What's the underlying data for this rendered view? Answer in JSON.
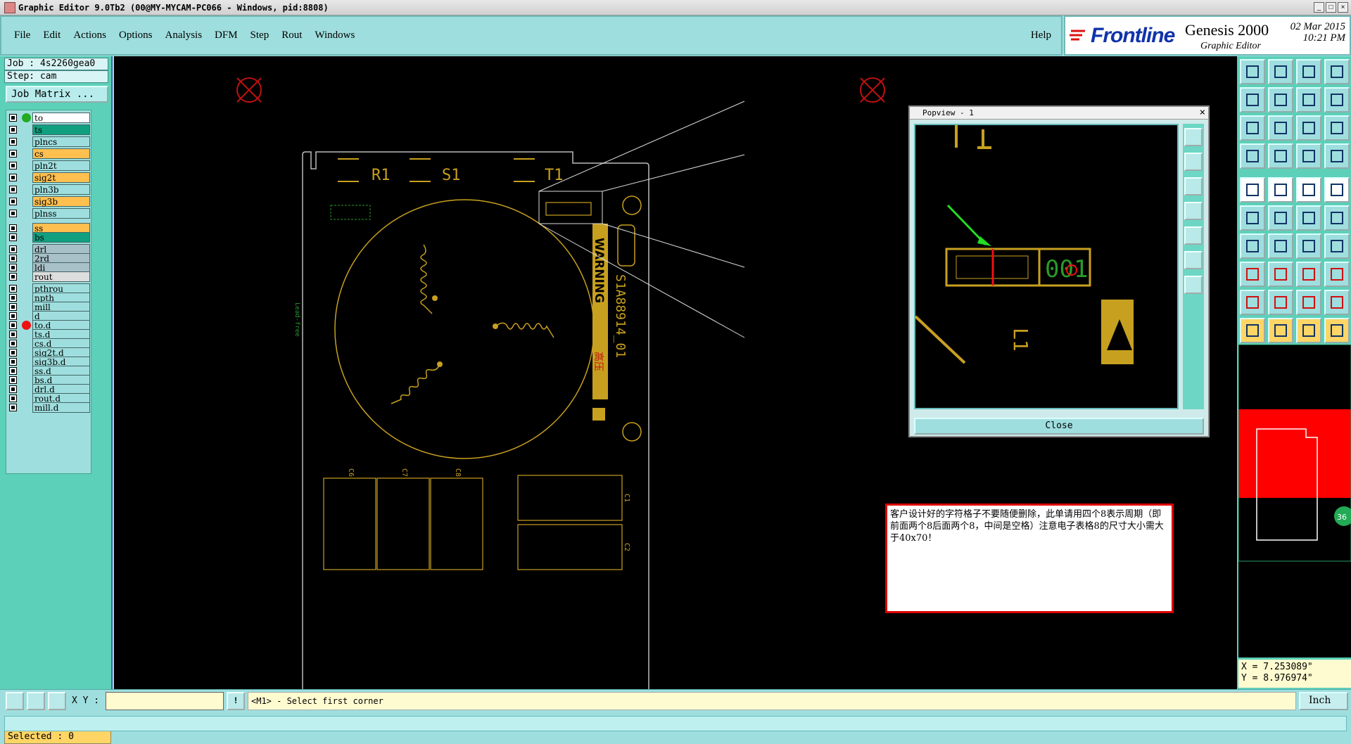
{
  "window": {
    "title": "Graphic Editor 9.0Tb2 (00@MY-MYCAM-PC066 - Windows, pid:8808)"
  },
  "menu": {
    "items": [
      "File",
      "Edit",
      "Actions",
      "Options",
      "Analysis",
      "DFM",
      "Step",
      "Rout",
      "Windows"
    ],
    "help": "Help"
  },
  "brand": {
    "logo": "Frontline",
    "product": "Genesis 2000",
    "subtitle": "Graphic Editor",
    "date": "02 Mar 2015",
    "time": "10:21 PM"
  },
  "job": {
    "job_line": "Job : 4s2260gea0",
    "step_line": "Step: cam",
    "matrix_button": "Job Matrix ..."
  },
  "layers": [
    {
      "name": "to",
      "color": "#ffffff",
      "dot": "#22aa22"
    },
    {
      "name": "ts",
      "color": "#10a080"
    },
    {
      "name": "plncs",
      "color": "#9fdede"
    },
    {
      "name": "cs",
      "color": "#ffc050"
    },
    {
      "name": "pln2t",
      "color": "#9fdede"
    },
    {
      "name": "sig2t",
      "color": "#ffc050"
    },
    {
      "name": "pln3b",
      "color": "#9fdede"
    },
    {
      "name": "sig3b",
      "color": "#ffc050"
    },
    {
      "name": "plnss",
      "color": "#9fdede"
    },
    {
      "name": "ss",
      "color": "#ffc050"
    },
    {
      "name": "bs",
      "color": "#10a080"
    },
    {
      "name": "drl",
      "color": "#a8c0c8"
    },
    {
      "name": "2rd",
      "color": "#a8c0c8"
    },
    {
      "name": "ldi",
      "color": "#a8c0c8"
    },
    {
      "name": "rout",
      "color": "#dddddd"
    },
    {
      "name": "pthrou",
      "color": "#9fdede"
    },
    {
      "name": "npth",
      "color": "#9fdede"
    },
    {
      "name": "mill",
      "color": "#9fdede"
    },
    {
      "name": "d",
      "color": "#9fdede"
    },
    {
      "name": "to.d",
      "color": "#9fdede",
      "dot": "#ee1111"
    },
    {
      "name": "ts.d",
      "color": "#9fdede"
    },
    {
      "name": "cs.d",
      "color": "#9fdede"
    },
    {
      "name": "sig2t.d",
      "color": "#9fdede"
    },
    {
      "name": "sig3b.d",
      "color": "#9fdede"
    },
    {
      "name": "ss.d",
      "color": "#9fdede"
    },
    {
      "name": "bs.d",
      "color": "#9fdede"
    },
    {
      "name": "drl.d",
      "color": "#9fdede"
    },
    {
      "name": "rout.d",
      "color": "#9fdede"
    },
    {
      "name": "mill.d",
      "color": "#9fdede"
    }
  ],
  "selected": "Selected : 0",
  "board": {
    "labels": [
      "R1",
      "S1",
      "T1"
    ],
    "part_number": "S1A88914_01",
    "warning": "WARNING",
    "hv_text": "高压",
    "cap_labels": [
      "C6",
      "C7",
      "C8",
      "C1",
      "C2"
    ],
    "lead_free": "Lead-free",
    "small_label": "L1"
  },
  "popview": {
    "title": "Popview - 1",
    "digits": "001",
    "label": "L1",
    "close": "Close"
  },
  "note": {
    "text": "客户设计好的字符格子不要随便删除，此单请用四个8表示周期（即前面两个8后面两个8，中间是空格）注意电子表格8的尺寸大小需大于40x70！"
  },
  "coords": {
    "x": "X = 7.253089\"",
    "y": "Y = 8.976974\""
  },
  "minimap": {
    "badge": "36"
  },
  "bottom": {
    "xy_label": "X Y :",
    "xy_value": "",
    "prompt": "<M1> - Select first corner",
    "units": "Inch"
  },
  "colors": {
    "accent": "#9fdede",
    "silk": "#c8a020",
    "alert": "#dd0000"
  }
}
